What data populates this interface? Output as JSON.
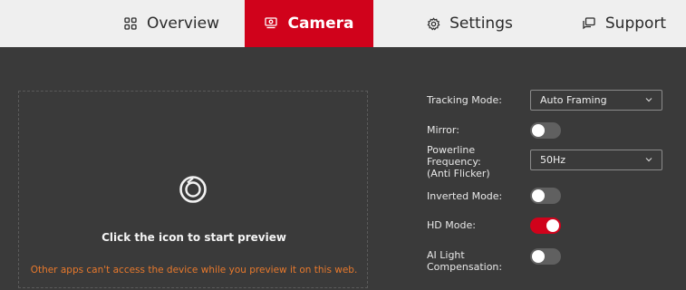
{
  "nav": {
    "tabs": [
      {
        "label": "Overview",
        "icon": "grid-icon"
      },
      {
        "label": "Camera",
        "icon": "camera-tab-icon",
        "active": true
      },
      {
        "label": "Settings",
        "icon": "gear-icon"
      },
      {
        "label": "Support",
        "icon": "chat-icon"
      }
    ]
  },
  "preview": {
    "hint": "Click the icon to start preview",
    "warning": "Other apps can't access the device while you preview it on this web."
  },
  "settings": {
    "tracking_mode": {
      "label": "Tracking Mode:",
      "value": "Auto Framing"
    },
    "mirror": {
      "label": "Mirror:",
      "on": false
    },
    "powerline": {
      "label_lines": [
        "Powerline",
        "Frequency:",
        "(Anti Flicker)"
      ],
      "value": "50Hz"
    },
    "inverted": {
      "label": "Inverted Mode:",
      "on": false
    },
    "hd_mode": {
      "label": "HD Mode:",
      "on": true
    },
    "ai_light": {
      "label_lines": [
        "AI Light",
        "Compensation:"
      ],
      "on": false
    }
  },
  "colors": {
    "accent": "#d0021b",
    "background": "#3a3a3a",
    "nav_bg": "#efefef",
    "warning": "#e8792c"
  }
}
